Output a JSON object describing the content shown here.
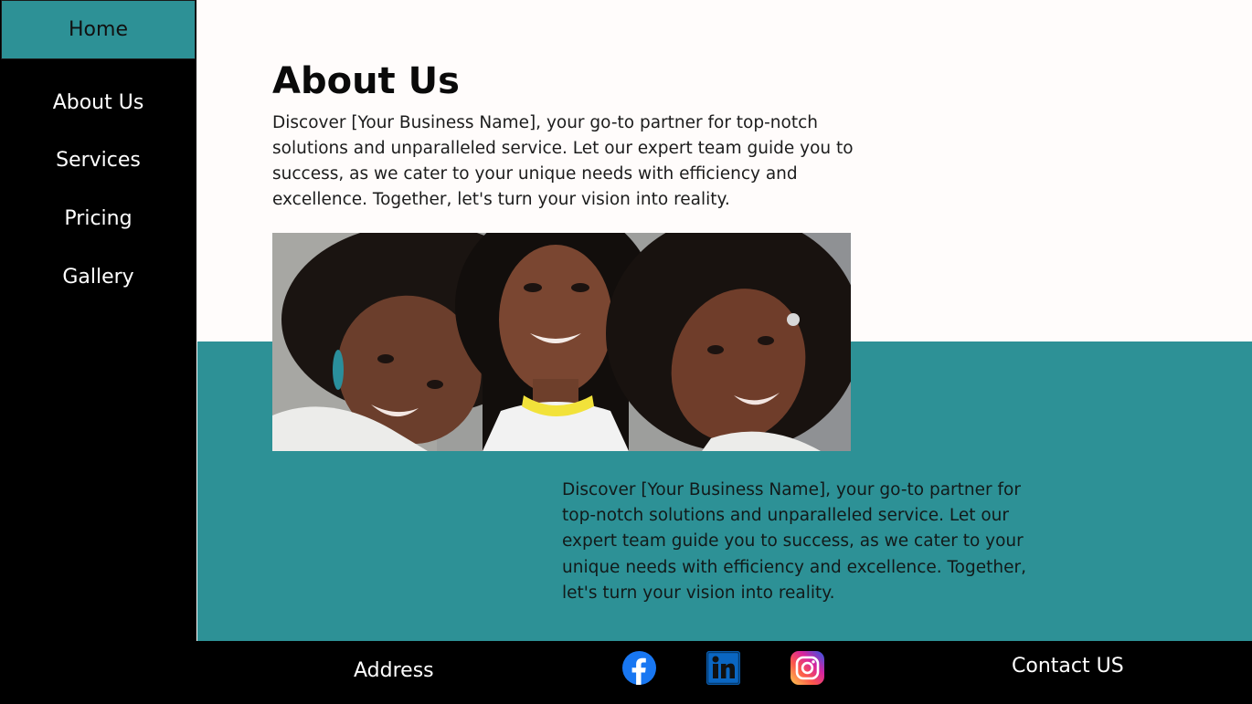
{
  "sidebar": {
    "home_label": "Home",
    "items": [
      {
        "label": "About Us"
      },
      {
        "label": "Services"
      },
      {
        "label": "Pricing"
      },
      {
        "label": "Gallery"
      }
    ]
  },
  "main": {
    "title": "About Us",
    "intro_text": "Discover [Your Business Name], your go-to partner for top-notch solutions and unparalleled service. Let our expert team guide you to success, as we cater to your unique needs with efficiency and excellence. Together, let's turn your vision into reality.",
    "photo_icon": "group-photo-three-women",
    "secondary_text": "Discover [Your Business Name], your go-to partner for top-notch solutions and unparalleled service. Let our expert team guide you to success, as we cater to your unique needs with efficiency and excellence. Together, let's turn your vision into reality."
  },
  "footer": {
    "address_label": "Address",
    "contact_label": "Contact US",
    "social": [
      {
        "icon": "facebook-icon",
        "color": "#1877f2"
      },
      {
        "icon": "linkedin-icon",
        "color": "#0a66c2"
      },
      {
        "icon": "instagram-icon",
        "color": "#e1306c"
      }
    ]
  },
  "colors": {
    "accent_teal": "#2d9196",
    "sidebar_bg": "#000000",
    "page_bg": "#fffcfb"
  }
}
